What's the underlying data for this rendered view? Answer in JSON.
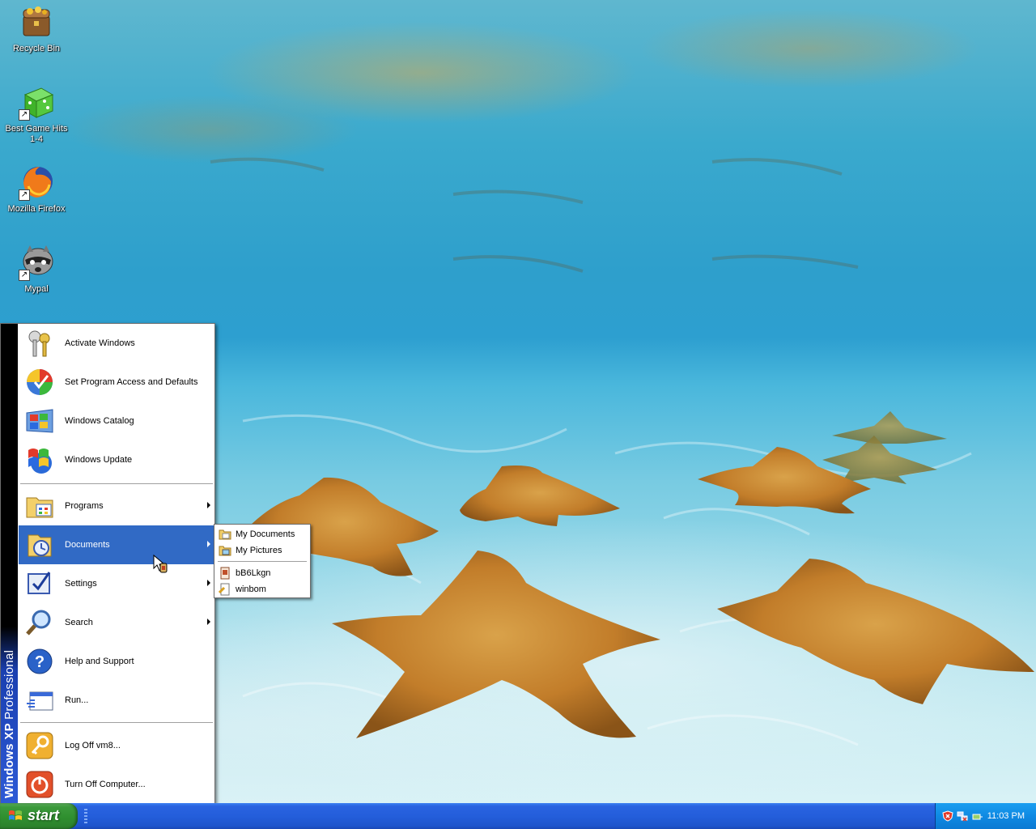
{
  "desktop": {
    "icons": [
      {
        "label": "Recycle Bin",
        "icon": "recycle-bin-icon"
      },
      {
        "label": "Best Game Hits 1-4",
        "icon": "game-dice-icon"
      },
      {
        "label": "Mozilla Firefox",
        "icon": "firefox-icon"
      },
      {
        "label": "Mypal",
        "icon": "mypal-raccoon-icon"
      }
    ]
  },
  "start_menu": {
    "band_title": "Windows XP",
    "band_edition": "Professional",
    "top_items": [
      {
        "label": "Activate Windows",
        "icon": "keys-icon"
      },
      {
        "label": "Set Program Access and Defaults",
        "icon": "program-access-icon"
      },
      {
        "label": "Windows Catalog",
        "icon": "windows-catalog-icon"
      },
      {
        "label": "Windows Update",
        "icon": "windows-update-icon"
      }
    ],
    "items": [
      {
        "label": "Programs",
        "icon": "programs-icon",
        "submenu": true
      },
      {
        "label": "Documents",
        "icon": "documents-icon",
        "submenu": true,
        "selected": true
      },
      {
        "label": "Settings",
        "icon": "settings-icon",
        "submenu": true
      },
      {
        "label": "Search",
        "icon": "search-icon",
        "submenu": true
      },
      {
        "label": "Help and Support",
        "icon": "help-icon"
      },
      {
        "label": "Run...",
        "icon": "run-icon"
      }
    ],
    "bottom_items": [
      {
        "label": "Log Off vm8...",
        "icon": "log-off-icon"
      },
      {
        "label": "Turn Off Computer...",
        "icon": "power-icon"
      }
    ]
  },
  "documents_submenu": {
    "items": [
      {
        "label": "My Documents",
        "icon": "folder-documents-icon"
      },
      {
        "label": "My Pictures",
        "icon": "folder-pictures-icon"
      },
      {
        "label": "bB6Lkgn",
        "icon": "file-icon"
      },
      {
        "label": "winbom",
        "icon": "text-file-icon"
      }
    ]
  },
  "taskbar": {
    "start_label": "start",
    "clock": "11:03 PM",
    "tray_icons": [
      "security-shield-icon",
      "network-icon",
      "safely-remove-icon"
    ]
  },
  "colors": {
    "taskbar_blue": "#245edb",
    "start_green": "#3c9a3c",
    "menu_highlight": "#316ac5",
    "tray_blue": "#0f8ae3"
  }
}
